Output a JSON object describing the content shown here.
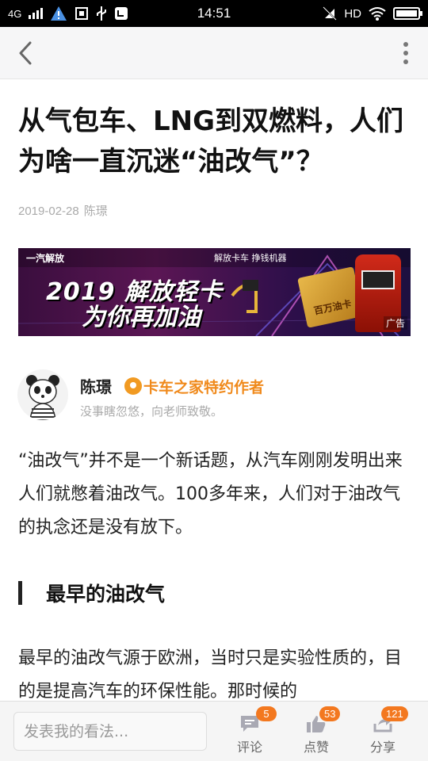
{
  "status_bar": {
    "network": "4G",
    "time": "14:51",
    "hd": "HD"
  },
  "nav": {
    "back_icon": "chevron-left-icon",
    "more_icon": "vertical-dots-icon"
  },
  "article": {
    "title": "从气包车、LNG到双燃料，人们为啥一直沉迷“油改气”？",
    "date": "2019-02-28",
    "author_short": "陈璟"
  },
  "ad": {
    "brand": "一汽解放",
    "brand2": "解放卡车 挣钱机器",
    "headline1": "2019 解放轻卡",
    "headline2": "为你再加油",
    "card_label": "百万油卡",
    "label": "广告"
  },
  "author": {
    "name": "陈璟",
    "badge": "卡车之家特约作者",
    "bio": "没事瞎忽悠，向老师致敬。"
  },
  "content": {
    "para1": "“油改气”并不是一个新话题，从汽车刚刚发明出来人们就憋着油改气。100多年来，人们对于油改气的执念还是没有放下。",
    "heading": "最早的油改气",
    "para2": "最早的油改气源于欧洲，当时只是实验性质的，目的是提高汽车的环保性能。那时候的"
  },
  "bottom_bar": {
    "input_placeholder": "发表我的看法...",
    "comment": {
      "label": "评论",
      "count": "5"
    },
    "like": {
      "label": "点赞",
      "count": "53"
    },
    "share": {
      "label": "分享",
      "count": "121"
    }
  },
  "colors": {
    "accent": "#f3781f",
    "badge_text": "#f08a1c",
    "nav_bg": "#f6f6f7"
  }
}
